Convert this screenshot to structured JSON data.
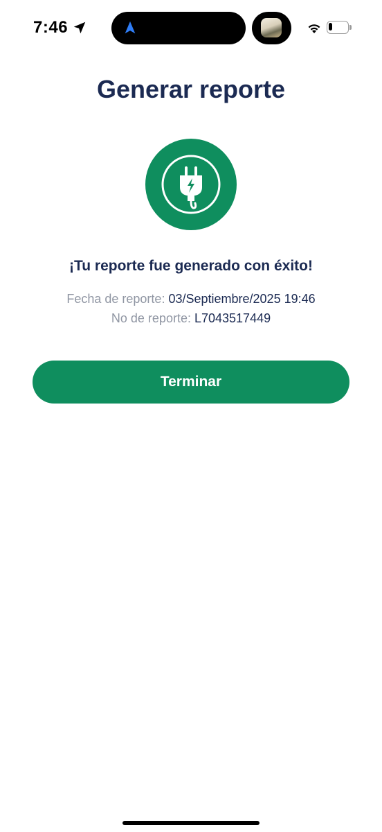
{
  "status_bar": {
    "time": "7:46",
    "location_icon": "location-arrow-icon",
    "navigation_icon": "navigation-arrow-icon",
    "wifi_icon": "wifi-icon",
    "battery_icon": "battery-icon",
    "battery_level": 0.2
  },
  "page": {
    "title": "Generar reporte",
    "status_icon": "plug-icon",
    "success_message": "¡Tu reporte fue generado con éxito!",
    "report_date_label": "Fecha de reporte:",
    "report_date_value": "03/Septiembre/2025 19:46",
    "report_number_label": "No de reporte:",
    "report_number_value": "L7043517449",
    "finish_button_label": "Terminar"
  },
  "colors": {
    "primary_green": "#0f8e5e",
    "title_navy": "#1b2a52",
    "label_gray": "#9096a3",
    "background": "#ffffff"
  }
}
